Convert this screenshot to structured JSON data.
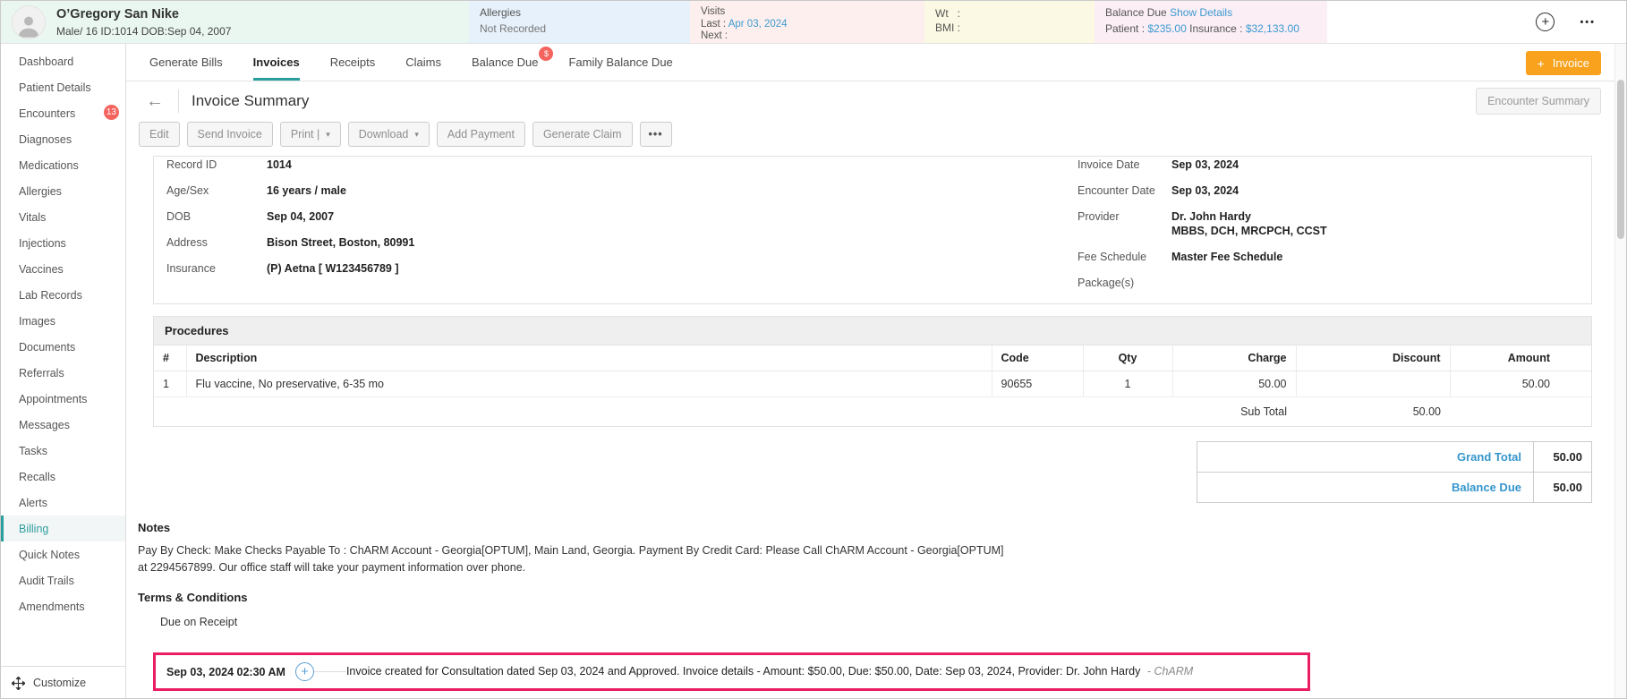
{
  "colors": {
    "accent_teal": "#2a9d9c",
    "link_blue": "#3d9ad1",
    "button_orange": "#f9a21d",
    "badge_red": "#f4645f",
    "highlight_pink": "#eb1d63"
  },
  "patient_banner": {
    "name": "O’Gregory San Nike",
    "demographics": "Male/ 16 ID:1014 DOB:Sep 04, 2007",
    "allergies": {
      "label": "Allergies",
      "value": "Not Recorded"
    },
    "visits": {
      "label": "Visits",
      "last_label": "Last  :",
      "last_value": "Apr 03, 2024",
      "next_label": "Next :"
    },
    "measures": {
      "wt_label": "Wt   :",
      "bmi_label": "BMI :"
    },
    "balance": {
      "label": "Balance Due",
      "details_link": "Show Details",
      "patient_label": "Patient :",
      "patient_value": "$235.00",
      "insurance_label": "Insurance :",
      "insurance_value": "$32,133.00"
    }
  },
  "sidebar": {
    "items": [
      {
        "label": "Dashboard"
      },
      {
        "label": "Patient Details"
      },
      {
        "label": "Encounters",
        "badge": "13"
      },
      {
        "label": "Diagnoses"
      },
      {
        "label": "Medications"
      },
      {
        "label": "Allergies"
      },
      {
        "label": "Vitals"
      },
      {
        "label": "Injections"
      },
      {
        "label": "Vaccines"
      },
      {
        "label": "Lab Records"
      },
      {
        "label": "Images"
      },
      {
        "label": "Documents"
      },
      {
        "label": "Referrals"
      },
      {
        "label": "Appointments"
      },
      {
        "label": "Messages"
      },
      {
        "label": "Tasks"
      },
      {
        "label": "Recalls"
      },
      {
        "label": "Alerts"
      },
      {
        "label": "Billing"
      },
      {
        "label": "Quick Notes"
      },
      {
        "label": "Audit Trails"
      },
      {
        "label": "Amendments"
      }
    ],
    "customize_label": "Customize"
  },
  "tabs": {
    "items": [
      {
        "label": "Generate Bills"
      },
      {
        "label": "Invoices"
      },
      {
        "label": "Receipts"
      },
      {
        "label": "Claims"
      },
      {
        "label": "Balance Due",
        "badge": "$"
      },
      {
        "label": "Family Balance Due"
      }
    ],
    "new_invoice_label": "Invoice"
  },
  "page": {
    "title": "Invoice Summary",
    "encounter_summary_label": "Encounter Summary",
    "actions": {
      "edit": "Edit",
      "send_invoice": "Send Invoice",
      "print": "Print |",
      "download": "Download",
      "add_payment": "Add Payment",
      "generate_claim": "Generate Claim"
    }
  },
  "details": {
    "left": [
      {
        "label": "Record ID",
        "value": "1014"
      },
      {
        "label": "Age/Sex",
        "value": "16 years / male"
      },
      {
        "label": "DOB",
        "value": "Sep 04, 2007"
      },
      {
        "label": "Address",
        "value": "Bison Street, Boston, 80991"
      },
      {
        "label": "Insurance",
        "value": "(P) Aetna [ W123456789 ]"
      }
    ],
    "right": [
      {
        "label": "Invoice Date",
        "value": "Sep 03, 2024"
      },
      {
        "label": "Encounter Date",
        "value": "Sep 03, 2024"
      },
      {
        "label": "Provider",
        "value": "Dr. John Hardy",
        "value2": "MBBS, DCH, MRCPCH, CCST"
      },
      {
        "label": "Fee Schedule",
        "value": "Master Fee Schedule"
      },
      {
        "label": "Package(s)",
        "value": ""
      }
    ]
  },
  "procedures": {
    "title": "Procedures",
    "columns": {
      "num": "#",
      "description": "Description",
      "code": "Code",
      "qty": "Qty",
      "charge": "Charge",
      "discount": "Discount",
      "amount": "Amount"
    },
    "rows": [
      {
        "num": "1",
        "description": "Flu vaccine, No preservative, 6-35 mo",
        "code": "90655",
        "qty": "1",
        "charge": "50.00",
        "discount": "",
        "amount": "50.00"
      }
    ],
    "subtotal": {
      "label": "Sub Total",
      "value": "50.00"
    }
  },
  "totals": {
    "rows": [
      {
        "label": "Grand Total",
        "value": "50.00"
      },
      {
        "label": "Balance Due",
        "value": "50.00"
      }
    ]
  },
  "notes": {
    "heading": "Notes",
    "line1": " Pay By Check: Make Checks Payable To : ChARM Account - Georgia[OPTUM], Main Land, Georgia. Payment By Credit Card: Please Call ChARM Account - Georgia[OPTUM]",
    "line2": "at 2294567899. Our office staff will take your payment information over phone."
  },
  "terms": {
    "heading": "Terms & Conditions",
    "body": "Due on Receipt"
  },
  "timeline": {
    "timestamp": "Sep 03, 2024 02:30 AM",
    "message": "Invoice created for Consultation dated Sep 03, 2024 and Approved. Invoice details - Amount: $50.00, Due: $50.00, Date: Sep 03, 2024, Provider: Dr. John Hardy",
    "brand": "- ChARM"
  },
  "icons": {
    "plus": "+",
    "more_horizontal": "•••",
    "caret_down": "▾",
    "back_arrow": "←",
    "ellipsis": "•••"
  }
}
